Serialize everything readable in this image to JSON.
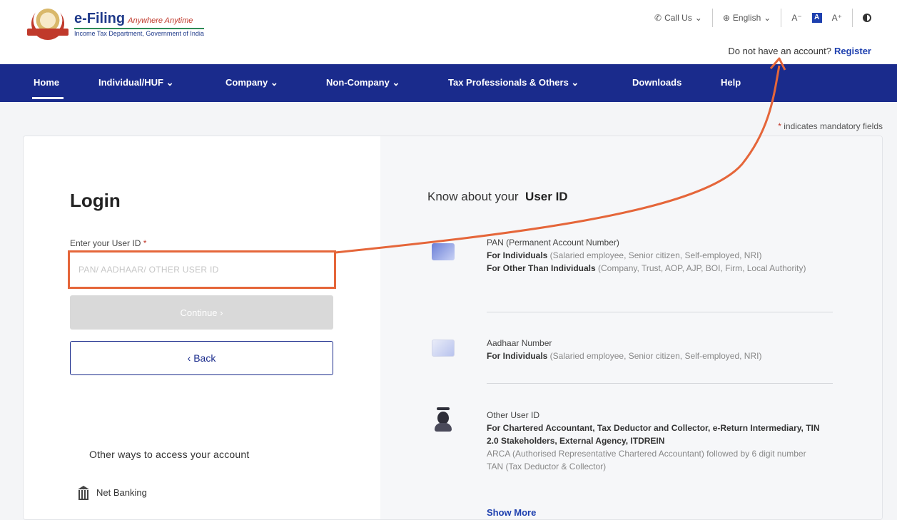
{
  "brand": {
    "title": "e-Filing",
    "tagline": "Anywhere Anytime",
    "subtitle": "Income Tax Department, Government of India"
  },
  "utilities": {
    "call_us": "Call Us",
    "language": "English",
    "font_decrease": "A⁻",
    "font_default": "A",
    "font_increase": "A⁺"
  },
  "register": {
    "prompt": "Do not have an account?",
    "link": "Register"
  },
  "nav": {
    "items": [
      {
        "label": "Home"
      },
      {
        "label": "Individual/HUF ⌄"
      },
      {
        "label": "Company ⌄"
      },
      {
        "label": "Non-Company ⌄"
      },
      {
        "label": "Tax Professionals & Others ⌄"
      },
      {
        "label": "Downloads"
      },
      {
        "label": "Help"
      }
    ]
  },
  "mandatory_note": "indicates mandatory fields",
  "login": {
    "title": "Login",
    "user_id_label": "Enter your User ID",
    "user_id_placeholder": "PAN/ AADHAAR/ OTHER USER ID",
    "user_id_value": "",
    "continue_label": "Continue ›",
    "back_label": "‹ Back",
    "other_ways": "Other ways to access your account",
    "net_banking": "Net Banking"
  },
  "know": {
    "title_prefix": "Know about your",
    "title_bold": "User ID",
    "pan": {
      "heading": "PAN (Permanent Account Number)",
      "line1_bold": "For Individuals",
      "line1_rest": " (Salaried employee, Senior citizen, Self-employed, NRI)",
      "line2_bold": "For Other Than Individuals",
      "line2_rest": " (Company, Trust, AOP, AJP, BOI, Firm, Local Authority)"
    },
    "aadhaar": {
      "heading": "Aadhaar Number",
      "line1_bold": "For Individuals",
      "line1_rest": " (Salaried employee, Senior citizen, Self-employed, NRI)"
    },
    "other": {
      "heading": "Other User ID",
      "line1_bold": "For Chartered Accountant, Tax Deductor and Collector, e-Return Intermediary, TIN 2.0 Stakeholders, External Agency, ITDREIN",
      "line2": "ARCA (Authorised Representative Chartered Accountant) followed by 6 digit number",
      "line3": "TAN (Tax Deductor & Collector)"
    },
    "show_more": "Show More"
  },
  "colors": {
    "nav_bg": "#1a2b8c",
    "accent_link": "#1e40af",
    "highlight": "#e5663a"
  }
}
